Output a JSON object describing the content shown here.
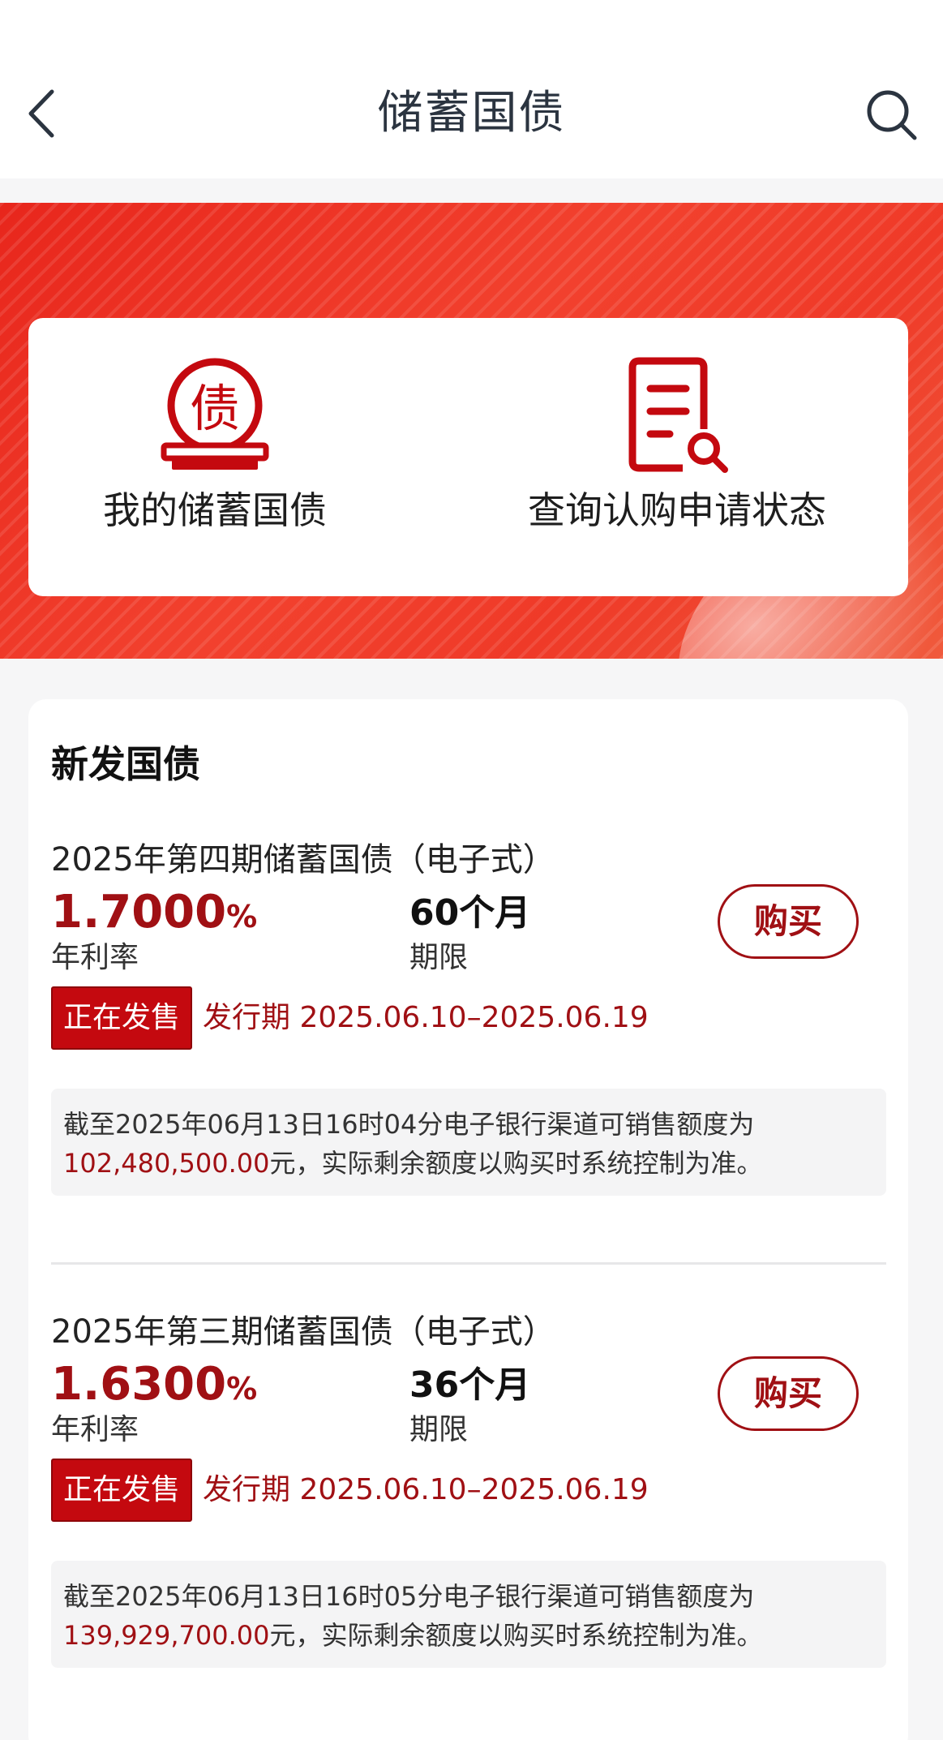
{
  "header": {
    "title": "储蓄国债",
    "back_icon": "chevron-left-icon",
    "search_icon": "search-icon"
  },
  "shortcuts": [
    {
      "label": "我的储蓄国债",
      "icon": "bond-coin-icon",
      "glyph": "债"
    },
    {
      "label": "查询认购申请状态",
      "icon": "document-search-icon"
    }
  ],
  "section": {
    "title": "新发国债"
  },
  "bonds": [
    {
      "name": "2025年第四期储蓄国债（电子式）",
      "rate": "1.7000",
      "rate_unit": "%",
      "rate_label": "年利率",
      "term": "60个月",
      "term_label": "期限",
      "buy_label": "购买",
      "status": "正在发售",
      "period_label": "发行期",
      "period": "2025.06.10–2025.06.19",
      "notice_prefix": "截至2025年06月13日16时04分电子银行渠道可销售额度为",
      "notice_amount": "102,480,500.00",
      "notice_suffix": "元，实际剩余额度以购买时系统控制为准。"
    },
    {
      "name": "2025年第三期储蓄国债（电子式）",
      "rate": "1.6300",
      "rate_unit": "%",
      "rate_label": "年利率",
      "term": "36个月",
      "term_label": "期限",
      "buy_label": "购买",
      "status": "正在发售",
      "period_label": "发行期",
      "period": "2025.06.10–2025.06.19",
      "notice_prefix": "截至2025年06月13日16时05分电子银行渠道可销售额度为",
      "notice_amount": "139,929,700.00",
      "notice_suffix": "元，实际剩余额度以购买时系统控制为准。"
    }
  ],
  "colors": {
    "brand_red": "#c4090f",
    "accent_text_red": "#a01014",
    "banner_red": "#ef3a28"
  }
}
